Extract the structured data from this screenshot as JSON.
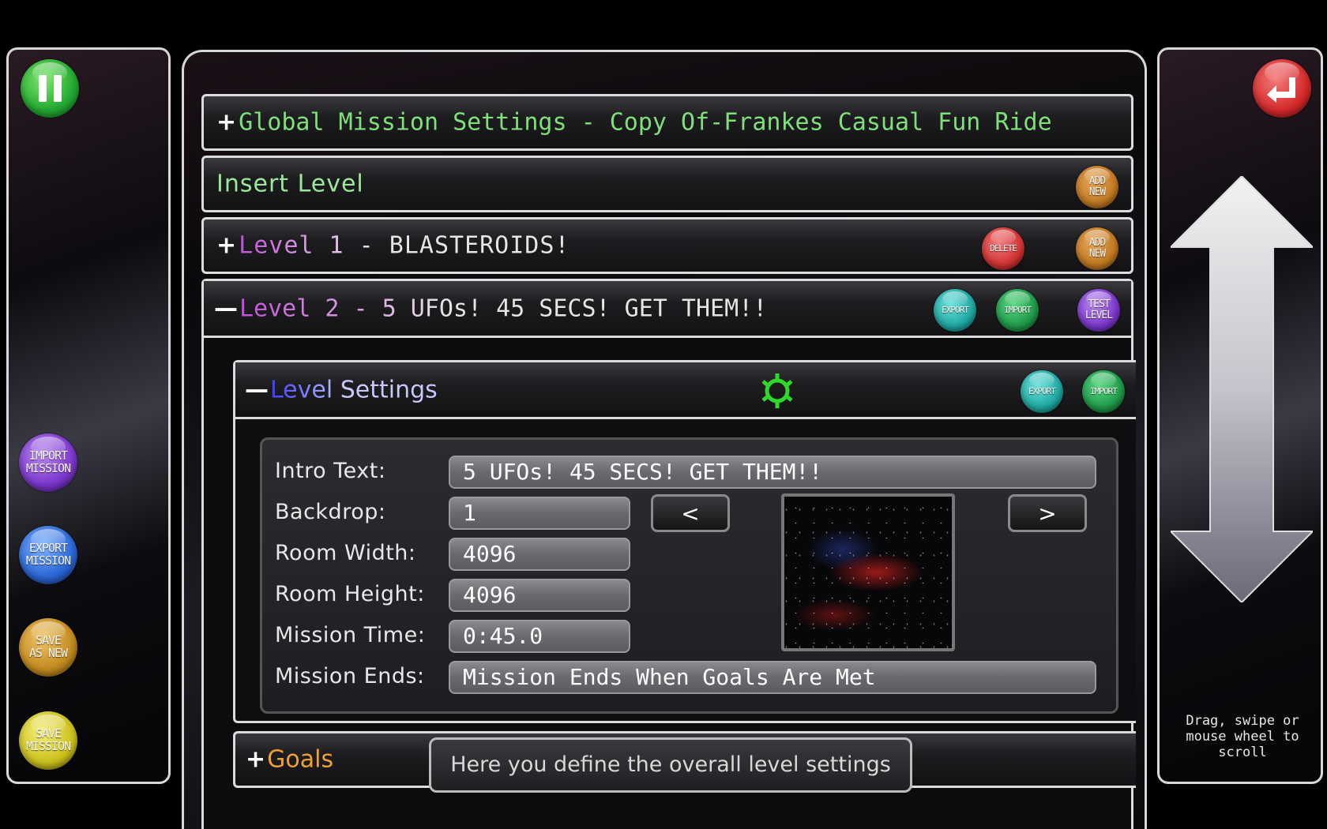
{
  "left_panel": {
    "pause_icon": "pause-icon",
    "buttons": [
      {
        "label": "IMPORT\nMISSION",
        "color": "#8a3fd6"
      },
      {
        "label": "EXPORT\nMISSION",
        "color": "#2e6fd8"
      },
      {
        "label": "SAVE\nAS NEW",
        "color": "#c99222"
      },
      {
        "label": "SAVE\nMISSION",
        "color": "#d8cf22"
      }
    ]
  },
  "right_panel": {
    "back_icon": "return-arrow-icon",
    "scroll_hint": "Drag, swipe or mouse wheel to scroll"
  },
  "main": {
    "global_settings": {
      "toggle": "+",
      "title": "Global Mission Settings - Copy Of-Frankes Casual Fun Ride"
    },
    "insert_level": {
      "title": "Insert Level",
      "add_label": "ADD\nNEW"
    },
    "level1": {
      "toggle": "+",
      "title": "Level 1 - BLASTEROIDS!",
      "delete_label": "DELETE",
      "add_label": "ADD\nNEW"
    },
    "level2": {
      "toggle": "—",
      "title": "Level 2 - 5 UFOs! 45 SECS! GET THEM!!",
      "export_label": "EXPORT",
      "import_label": "IMPORT",
      "test_label": "TEST\nLEVEL"
    },
    "level_settings": {
      "toggle": "—",
      "title": "Level Settings",
      "export_label": "EXPORT",
      "import_label": "IMPORT",
      "fields": {
        "intro_text_label": "Intro Text:",
        "intro_text_value": "5 UFOs! 45 SECS! GET THEM!!",
        "backdrop_label": "Backdrop:",
        "backdrop_value": "1",
        "prev_label": "<",
        "next_label": ">",
        "room_width_label": "Room Width:",
        "room_width_value": "4096",
        "room_height_label": "Room Height:",
        "room_height_value": "4096",
        "mission_time_label": "Mission Time:",
        "mission_time_value": "0:45.0",
        "mission_ends_label": "Mission Ends:",
        "mission_ends_value": "Mission Ends When Goals Are Met"
      }
    },
    "goals": {
      "toggle": "+",
      "title": "Goals"
    },
    "tooltip": "Here you define the overall level settings"
  },
  "colors": {
    "global_title": "#7fe07a",
    "insert_title": "#9be89a",
    "level_title_gradient": [
      "#c24fd8",
      "#e6e6e6"
    ],
    "settings_title_gradient": [
      "#3c3cff",
      "#c8c8ff"
    ],
    "goals_title": "#f0a030",
    "export_orb": "#29b6b0",
    "import_orb": "#1f9a4a",
    "test_orb": "#8a3fd6",
    "add_orb": "#c9822a",
    "delete_orb": "#d63a3a"
  }
}
